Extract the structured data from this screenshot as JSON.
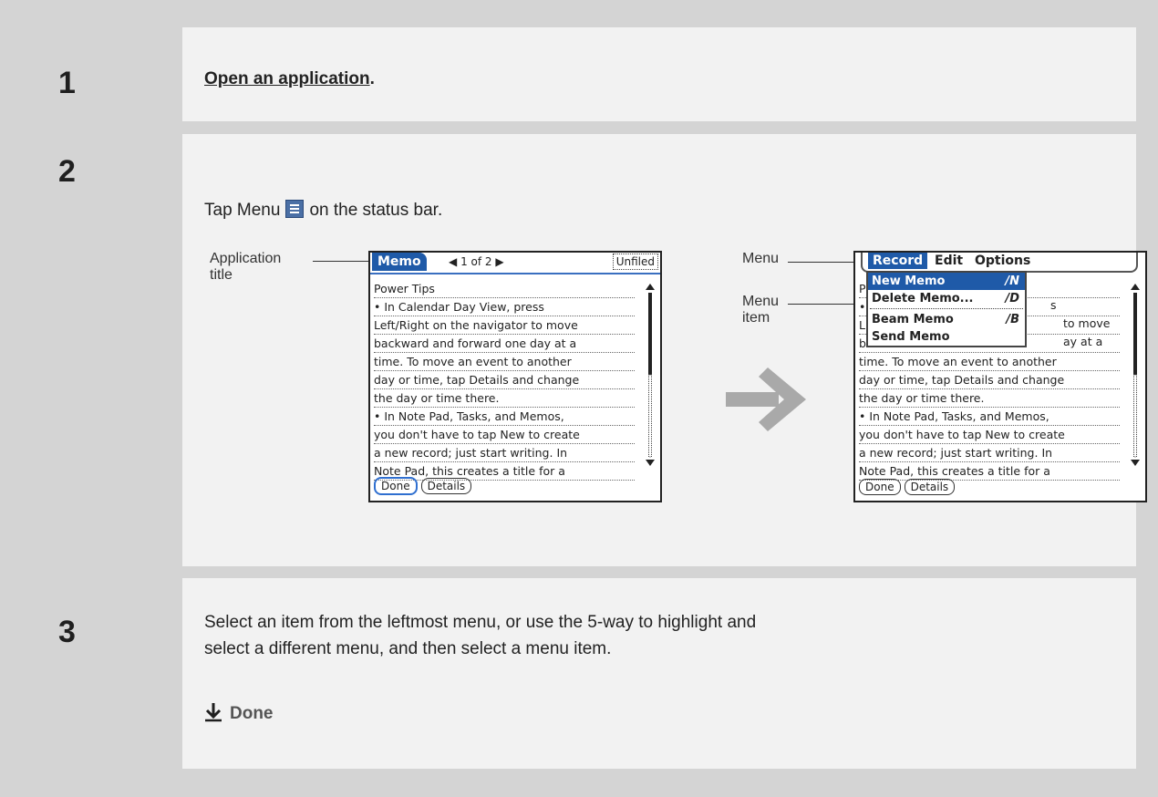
{
  "steps": [
    {
      "number": "1",
      "link_text": "Open an application",
      "after": "."
    },
    {
      "number": "2",
      "text_before": "Tap Menu",
      "text_after": "on the status bar."
    },
    {
      "number": "3",
      "text": "Select an item from the leftmost menu, or use the 5-way to highlight and select a different menu, and then select a menu item.",
      "done_label": "Done"
    }
  ],
  "callouts": {
    "application_title_1": "Application",
    "application_title_2": "title",
    "menu": "Menu",
    "menu_item_1": "Menu",
    "menu_item_2": "item"
  },
  "screen_left": {
    "app_title": "Memo",
    "pager": "1 of 2",
    "category": "Unfiled",
    "lines": [
      "Power Tips",
      "• In Calendar Day View, press",
      "Left/Right on the navigator to move",
      "backward and forward one day at a",
      "time. To move an event to another",
      "day or time, tap Details and change",
      "the day or time there.",
      "• In Note Pad, Tasks, and Memos,",
      "you don't have to tap New to create",
      "a new record; just start writing. In",
      "Note Pad, this creates a title for a"
    ],
    "buttons": [
      "Done",
      "Details"
    ]
  },
  "screen_right": {
    "menus": [
      "Record",
      "Edit",
      "Options"
    ],
    "items": [
      {
        "label": "New Memo",
        "shortcut": "/N"
      },
      {
        "label": "Delete Memo...",
        "shortcut": "/D"
      },
      {
        "label": "Beam Memo",
        "shortcut": "/B"
      },
      {
        "label": "Send Memo",
        "shortcut": ""
      }
    ],
    "lines": [
      "P",
      "•",
      "L",
      "b",
      "time. To move an event to another",
      "day or time, tap Details and change",
      "the day or time there.",
      "• In Note Pad, Tasks, and Memos,",
      "you don't have to tap New to create",
      "a new record; just start writing. In",
      "Note Pad, this creates a title for a"
    ],
    "visible_fragments": [
      "s",
      "to move",
      "ay at a"
    ],
    "buttons": [
      "Done",
      "Details"
    ]
  }
}
